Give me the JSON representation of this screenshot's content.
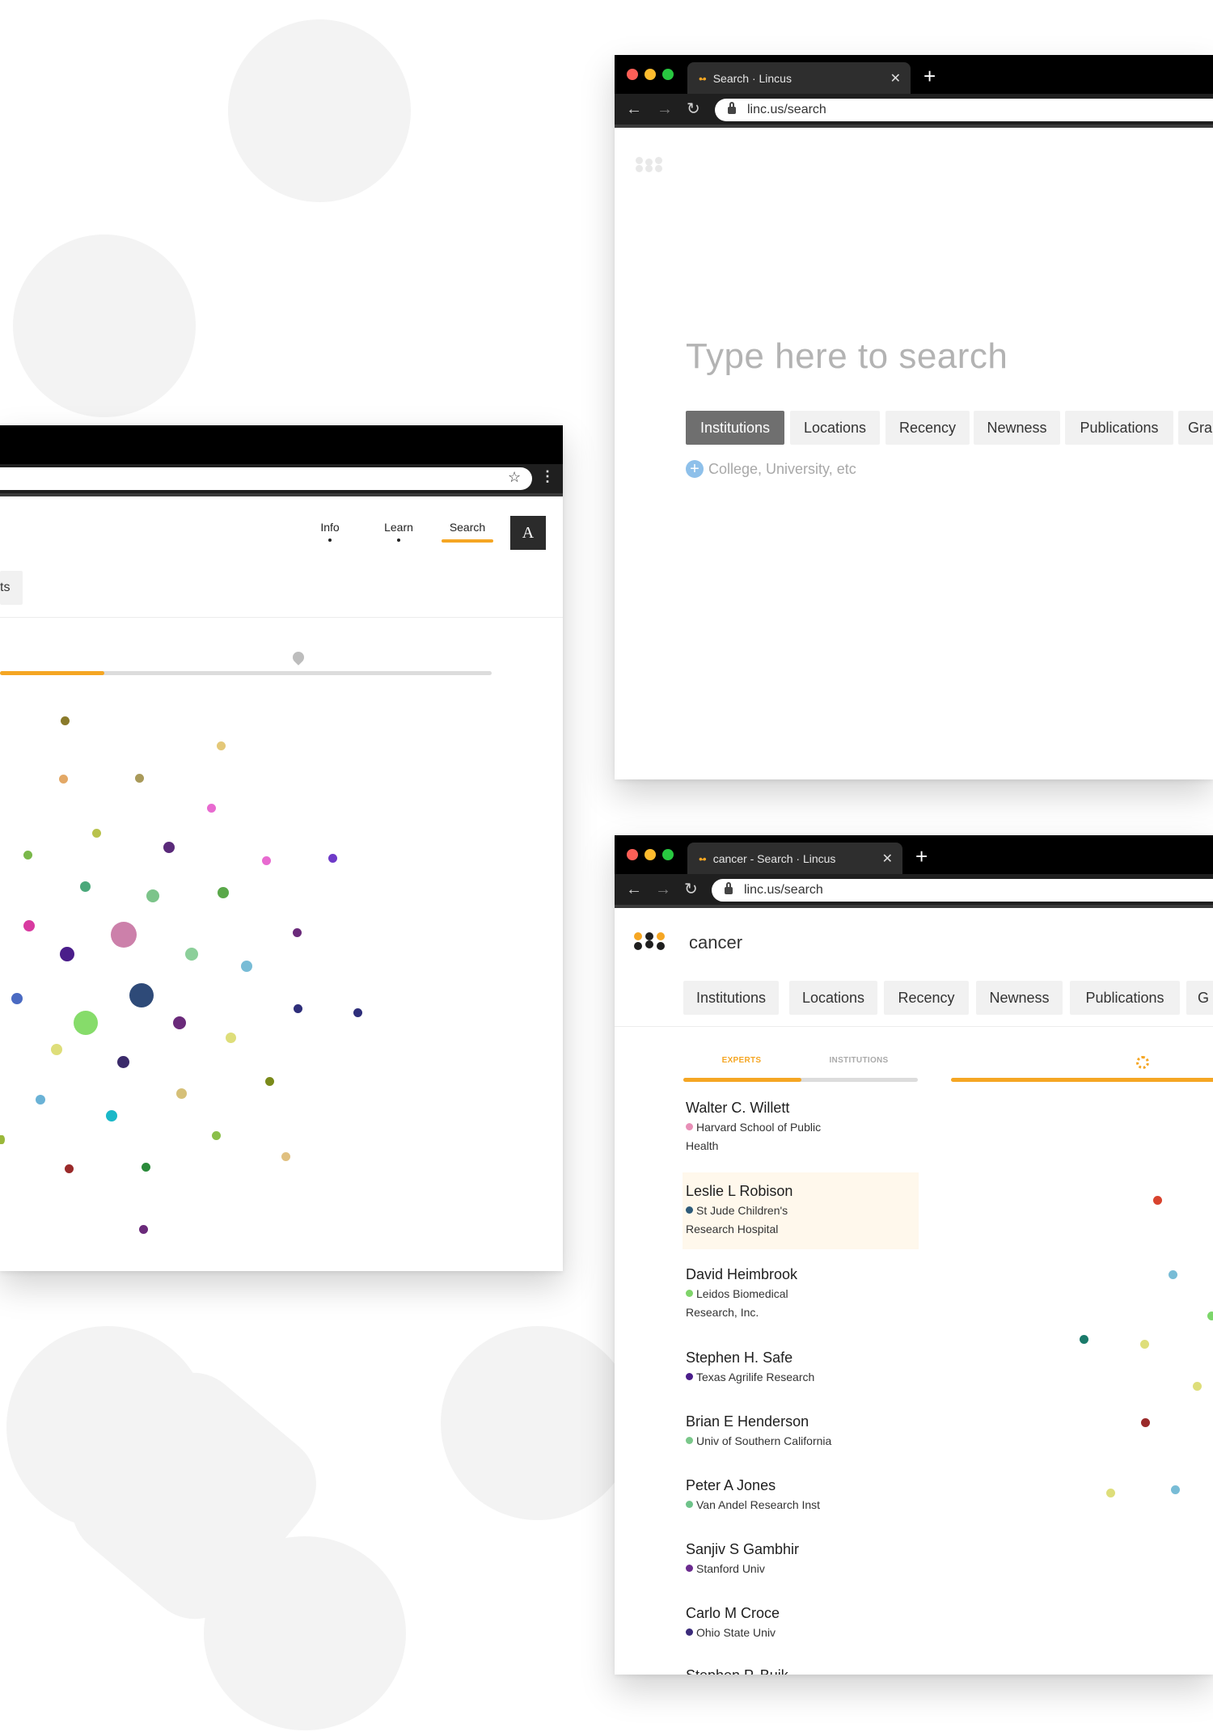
{
  "window_left": {
    "nav": {
      "info": "Info",
      "learn": "Learn",
      "search": "Search",
      "account_badge": "A"
    },
    "filter_fragment": "ts",
    "progress": 0.22
  },
  "window_search": {
    "tab_title": "Search · Lincus",
    "url": "linc.us/search",
    "placeholder": "Type here to search",
    "filters": [
      "Institutions",
      "Locations",
      "Recency",
      "Newness",
      "Publications",
      "Gra"
    ],
    "active_filter": "Institutions",
    "hint": "College, University, etc"
  },
  "window_results": {
    "tab_title": "cancer - Search · Lincus",
    "url": "linc.us/search",
    "query": "cancer",
    "filters": [
      "Institutions",
      "Locations",
      "Recency",
      "Newness",
      "Publications",
      "G"
    ],
    "tabs": {
      "experts": "EXPERTS",
      "institutions": "INSTITUTIONS"
    },
    "experts": [
      {
        "name": "Walter C. Willett",
        "inst1": "Harvard School of Public",
        "inst2": "Health",
        "color": "#e88fb7"
      },
      {
        "name": "Leslie L Robison",
        "inst1": "St Jude Children's",
        "inst2": "Research Hospital",
        "color": "#2e5b7a"
      },
      {
        "name": "David Heimbrook",
        "inst1": "Leidos Biomedical",
        "inst2": "Research, Inc.",
        "color": "#7fd46a"
      },
      {
        "name": "Stephen H. Safe",
        "inst1": "Texas Agrilife Research",
        "inst2": "",
        "color": "#4a1d8a"
      },
      {
        "name": "Brian E Henderson",
        "inst1": "Univ of Southern California",
        "inst2": "",
        "color": "#7ac78a"
      },
      {
        "name": "Peter A Jones",
        "inst1": "Van Andel Research Inst",
        "inst2": "",
        "color": "#6ec38a"
      },
      {
        "name": "Sanjiv S Gambhir",
        "inst1": "Stanford Univ",
        "inst2": "",
        "color": "#6b2b8f"
      },
      {
        "name": "Carlo M Croce",
        "inst1": "Ohio State Univ",
        "inst2": "",
        "color": "#3b2b7a"
      }
    ],
    "partial_last_name": "Stephen P. Buik"
  },
  "colors": {
    "accent": "#f5a623",
    "brand_dark": "#1f1f1f"
  }
}
